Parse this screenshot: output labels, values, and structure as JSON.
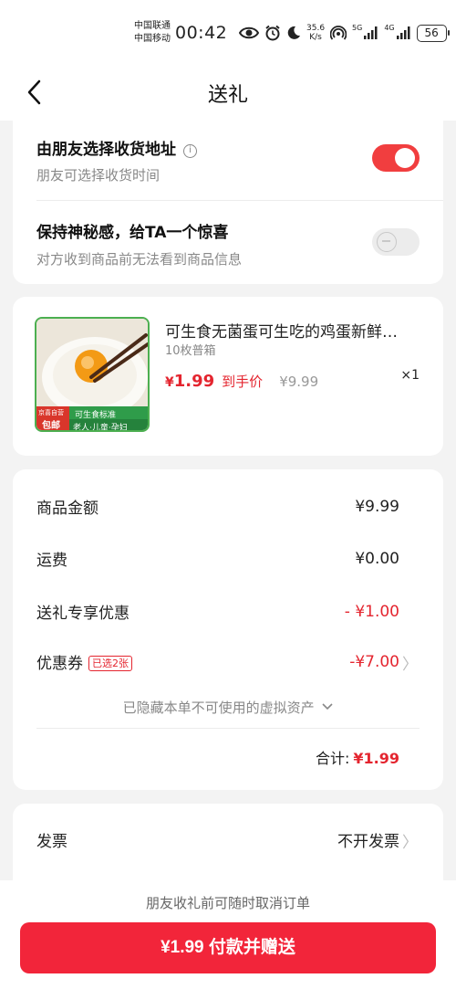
{
  "status_bar": {
    "carrier_1": "中国联通",
    "carrier_2": "中国移动",
    "time": "00:42",
    "net_speed_value": "35.6",
    "net_speed_unit": "K/s",
    "sig_1_label": "5G",
    "sig_2_label": "4G",
    "battery": "56"
  },
  "nav": {
    "title": "送礼"
  },
  "options": {
    "friend_address_title": "由朋友选择收货地址",
    "friend_address_sub": "朋友可选择收货时间",
    "friend_address_on": true,
    "mystery_title": "保持神秘感，给TA一个惊喜",
    "mystery_sub": "对方收到商品前无法看到商品信息",
    "mystery_on": false
  },
  "product": {
    "name": "可生食无菌蛋可生吃的鸡蛋新鲜…",
    "spec": "10枚普箱",
    "price_symbol": "¥",
    "price_value": "1.99",
    "price_tag": "到手价",
    "original_price": "¥9.99",
    "quantity": "×1",
    "image_badges": {
      "seller": "京喜自营",
      "free_ship": "包邮",
      "standard": "可生食标准",
      "audience": "老人·儿童·孕妇"
    }
  },
  "summary": {
    "goods_amount_label": "商品金额",
    "goods_amount_value": "¥9.99",
    "shipping_label": "运费",
    "shipping_value": "¥0.00",
    "gift_discount_label": "送礼专享优惠",
    "gift_discount_value": "- ¥1.00",
    "coupon_label": "优惠券",
    "coupon_badge": "已选2张",
    "coupon_value": "-¥7.00",
    "hidden_assets": "已隐藏本单不可使用的虚拟资产",
    "total_label": "合计:",
    "total_value": "¥1.99"
  },
  "invoice": {
    "label": "发票",
    "value": "不开发票"
  },
  "bottom": {
    "note": "朋友收礼前可随时取消订单",
    "pay_button": "¥1.99 付款并赠送"
  },
  "colors": {
    "accent_red": "#e4252f",
    "button_red": "#f2253a",
    "toggle_on": "#f13e3f"
  }
}
